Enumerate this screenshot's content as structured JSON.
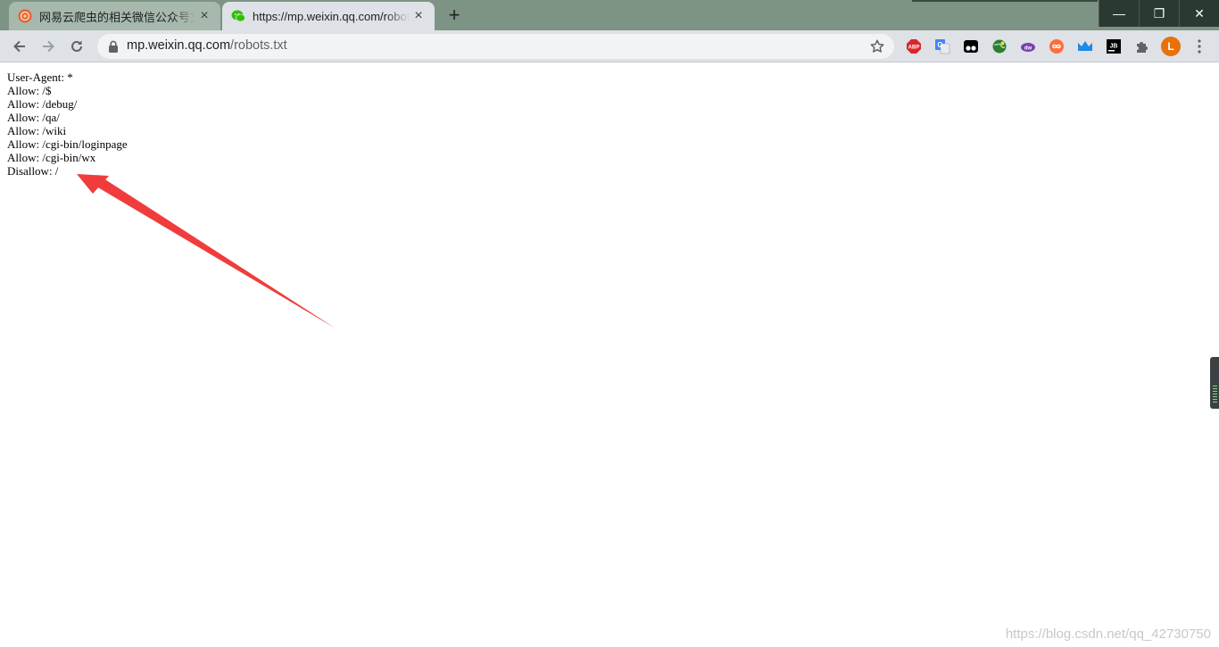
{
  "tabs": [
    {
      "title": "网易云爬虫的相关微信公众号文章",
      "favicon": "netease-favicon",
      "active": false
    },
    {
      "title": "https://mp.weixin.qq.com/robots.txt",
      "favicon": "wechat-favicon",
      "active": true
    }
  ],
  "window_controls": {
    "minimize": "—",
    "restore": "❐",
    "close": "✕"
  },
  "new_tab_label": "+",
  "address_bar": {
    "host": "mp.weixin.qq.com",
    "path": "/robots.txt"
  },
  "profile": {
    "initial": "L"
  },
  "extensions": [
    "abp-icon",
    "google-translate-icon",
    "tampermonkey-icon",
    "globe-extension-icon",
    "download-extension-icon",
    "infinity-extension-icon",
    "crown-extension-icon",
    "jetbrains-icon",
    "puzzle-icon"
  ],
  "robots_lines": [
    "User-Agent: *",
    "Allow: /$",
    "Allow: /debug/",
    "Allow: /qa/",
    "Allow: /wiki",
    "Allow: /cgi-bin/loginpage",
    "Allow: /cgi-bin/wx",
    "Disallow: /"
  ],
  "watermark": "https://blog.csdn.net/qq_42730750",
  "colors": {
    "arrow": "#f03c3c",
    "accent": "#e8710a"
  }
}
